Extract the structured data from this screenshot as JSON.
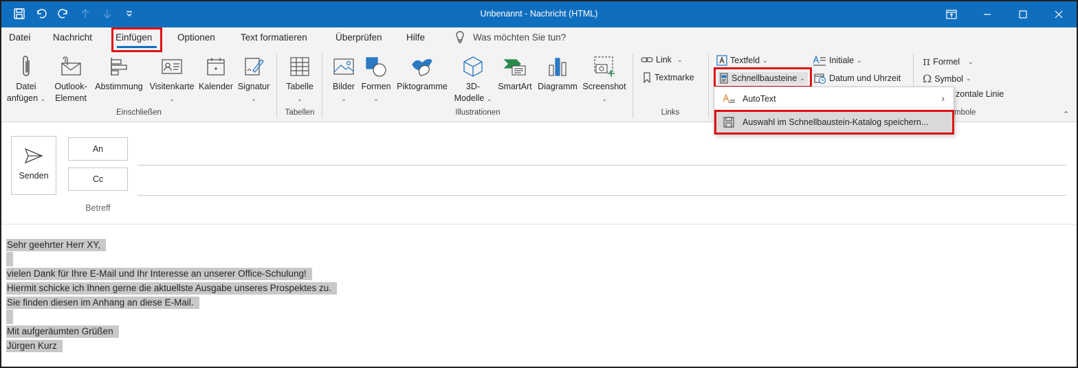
{
  "window": {
    "title": "Unbenannt  -  Nachricht (HTML)",
    "title_bar_color": "#106ebe"
  },
  "tabs": [
    {
      "label": "Datei"
    },
    {
      "label": "Nachricht"
    },
    {
      "label": "Einfügen",
      "active": true
    },
    {
      "label": "Optionen"
    },
    {
      "label": "Text formatieren"
    },
    {
      "label": "Überprüfen"
    },
    {
      "label": "Hilfe"
    }
  ],
  "tell_me": "Was möchten Sie tun?",
  "ribbon": {
    "include": {
      "group_label": "Einschließen",
      "attach_1": "Datei",
      "attach_2": "anfügen",
      "outlook_item_1": "Outlook-",
      "outlook_item_2": "Element",
      "poll": "Abstimmung",
      "business_card": "Visitenkarte",
      "calendar": "Kalender",
      "signature": "Signatur"
    },
    "tables": {
      "group_label": "Tabellen",
      "table": "Tabelle"
    },
    "illustrations": {
      "group_label": "Illustrationen",
      "pictures": "Bilder",
      "shapes": "Formen",
      "icons": "Piktogramme",
      "models_1": "3D-",
      "models_2": "Modelle",
      "smartart": "SmartArt",
      "chart": "Diagramm",
      "screenshot": "Screenshot"
    },
    "links": {
      "group_label": "Links",
      "link": "Link",
      "bookmark": "Textmarke"
    },
    "text": {
      "textbox": "Textfeld",
      "quick_parts": "Schnellbausteine",
      "dropcap": "Initiale",
      "date_time": "Datum und Uhrzeit"
    },
    "symbols": {
      "group_label_partial": "mbole",
      "equation": "Formel",
      "symbol": "Symbol",
      "hline_partial": "zontale Linie"
    }
  },
  "quick_parts_menu": {
    "autotext": "AutoText",
    "save_selection": "Auswahl im Schnellbaustein-Katalog speichern..."
  },
  "compose": {
    "send": "Senden",
    "to": "An",
    "cc": "Cc",
    "subject": "Betreff"
  },
  "body_lines": [
    "Sehr geehrter Herr XY,",
    "",
    "vielen Dank für Ihre E-Mail und Ihr Interesse an unserer Office-Schulung!",
    "Hiermit schicke ich Ihnen gerne die aktuellste Ausgabe unseres Prospektes zu.",
    "Sie finden diesen im Anhang an diese E-Mail.",
    "",
    "Mit aufgeräumten Grüßen",
    "Jürgen Kurz"
  ],
  "colors": {
    "accent": "#106ebe",
    "highlight_box": "#e01010",
    "selection": "#c8c8c8",
    "ribbon_bg": "#f3f3f3"
  }
}
